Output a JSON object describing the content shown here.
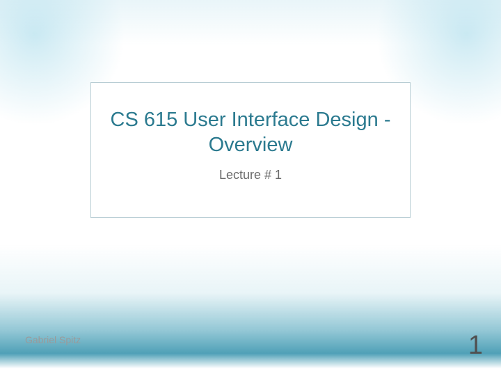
{
  "slide": {
    "title": "CS 615 User Interface Design - Overview",
    "subtitle": "Lecture # 1",
    "author": "Gabriel Spitz",
    "page_number": "1"
  }
}
